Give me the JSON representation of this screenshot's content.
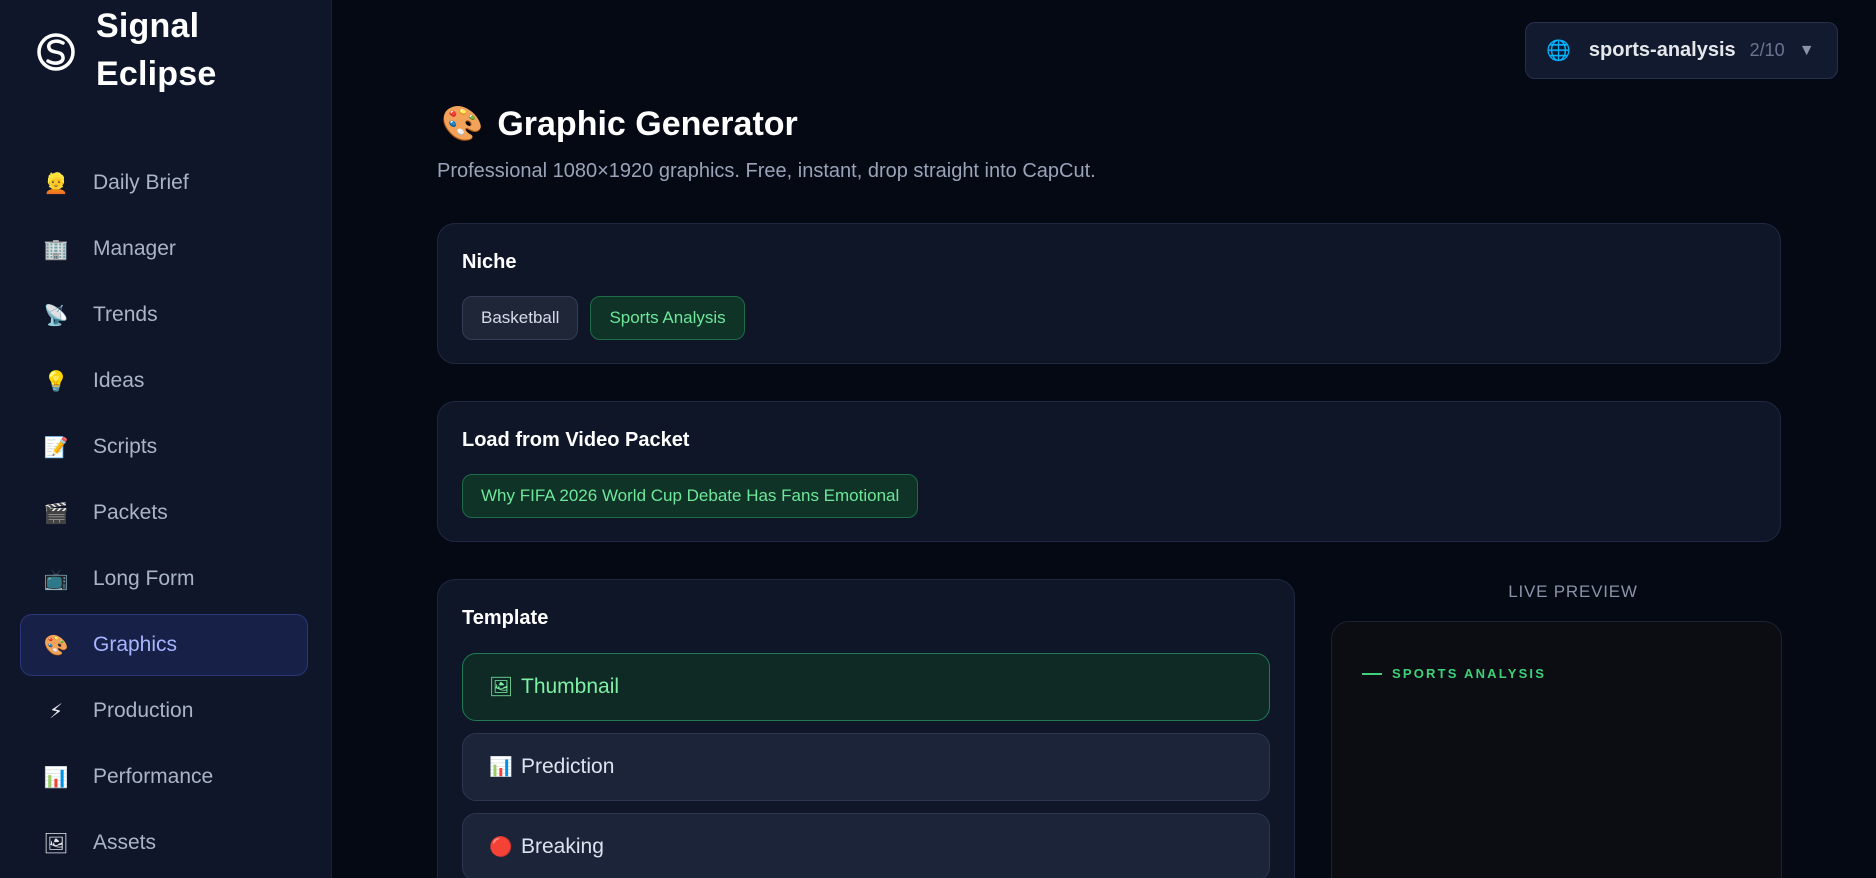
{
  "brand": {
    "name_line1": "Signal",
    "name_line2": "Eclipse",
    "logo_icon": "signal-eclipse-logo"
  },
  "sidebar": {
    "items": [
      {
        "icon": "👱",
        "icon_name": "person-icon",
        "label": "Daily Brief",
        "active": false
      },
      {
        "icon": "🏢",
        "icon_name": "office-building-icon",
        "label": "Manager",
        "active": false
      },
      {
        "icon": "📡",
        "icon_name": "satellite-dish-icon",
        "label": "Trends",
        "active": false
      },
      {
        "icon": "💡",
        "icon_name": "lightbulb-icon",
        "label": "Ideas",
        "active": false
      },
      {
        "icon": "📝",
        "icon_name": "memo-icon",
        "label": "Scripts",
        "active": false
      },
      {
        "icon": "🎬",
        "icon_name": "clapper-board-icon",
        "label": "Packets",
        "active": false
      },
      {
        "icon": "📺",
        "icon_name": "television-icon",
        "label": "Long Form",
        "active": false
      },
      {
        "icon": "🎨",
        "icon_name": "palette-icon",
        "label": "Graphics",
        "active": true
      },
      {
        "icon": "⚡",
        "icon_name": "lightning-icon",
        "label": "Production",
        "active": false
      },
      {
        "icon": "📊",
        "icon_name": "bar-chart-icon",
        "label": "Performance",
        "active": false
      },
      {
        "icon": "🖼",
        "icon_name": "framed-picture-icon",
        "label": "Assets",
        "active": false
      }
    ]
  },
  "workspace": {
    "icon": "🌐",
    "name": "sports-analysis",
    "count": "2/10",
    "caret": "▼"
  },
  "page": {
    "title_icon": "🎨",
    "title": "Graphic Generator",
    "subtitle": "Professional 1080×1920 graphics. Free, instant, drop straight into CapCut."
  },
  "niche": {
    "title": "Niche",
    "options": [
      {
        "label": "Basketball",
        "selected": false
      },
      {
        "label": "Sports Analysis",
        "selected": true
      }
    ]
  },
  "packet": {
    "title": "Load from Video Packet",
    "items": [
      {
        "label": "Why FIFA 2026 World Cup Debate Has Fans Emotional"
      }
    ]
  },
  "template": {
    "title": "Template",
    "items": [
      {
        "icon": "🖼",
        "label": "Thumbnail",
        "active": true
      },
      {
        "icon": "📊",
        "label": "Prediction",
        "active": false
      },
      {
        "icon": "🔴",
        "label": "Breaking",
        "active": false
      }
    ]
  },
  "preview": {
    "label": "LIVE PREVIEW",
    "tag": "SPORTS ANALYSIS"
  },
  "colors": {
    "accent_green": "#3fd17a",
    "active_nav": "#a7b4ff",
    "background": "#050914"
  }
}
